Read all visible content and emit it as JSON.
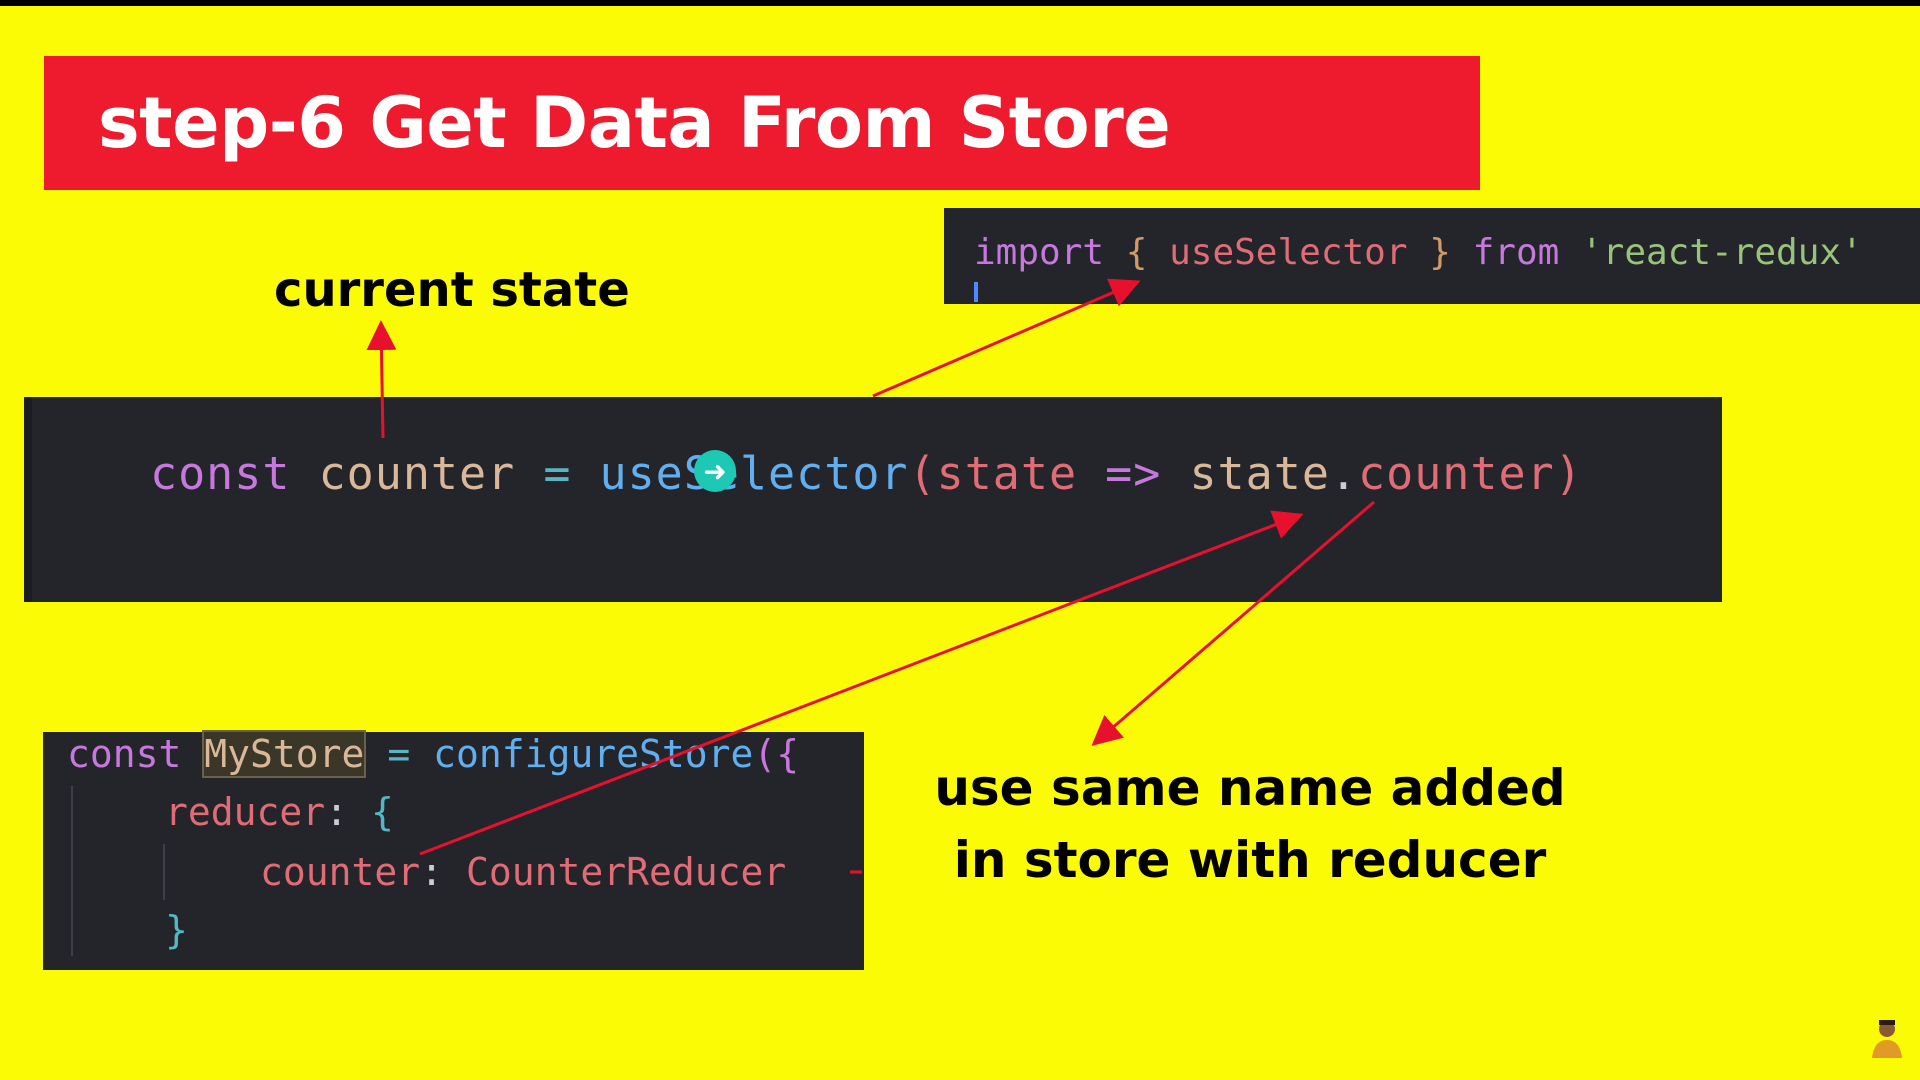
{
  "slide": {
    "title": "step-6 Get Data From Store",
    "label_current_state": "current state",
    "note_line1": "use same name added",
    "note_line2": "in store with reducer"
  },
  "import_code": {
    "kw_import": "import",
    "brace_open": "{",
    "name": "useSelector",
    "brace_close": "}",
    "kw_from": "from",
    "module": "'react-redux'"
  },
  "main_code": {
    "kw_const": "const",
    "var": "counter",
    "eq": "=",
    "fn": "useSelector",
    "paren_open": "(",
    "param": "state",
    "arrow": "=>",
    "obj": "state",
    "dot": ".",
    "prop": "counter",
    "paren_close": ")"
  },
  "store_code": {
    "kw_const": "const",
    "name": "MyStore",
    "eq": "=",
    "fn": "configureStore",
    "open": "({",
    "reducer_key": "reducer",
    "colon": ":",
    "brace": "{",
    "counter_key": "counter",
    "counter_val": "CounterReducer",
    "close": "}"
  },
  "colors": {
    "background": "#fbfb06",
    "banner": "#ee1a2e",
    "code_bg": "#23252b",
    "arrow": "#e8112d"
  },
  "icons": [
    "cursor-arrow-icon",
    "avatar-icon"
  ]
}
